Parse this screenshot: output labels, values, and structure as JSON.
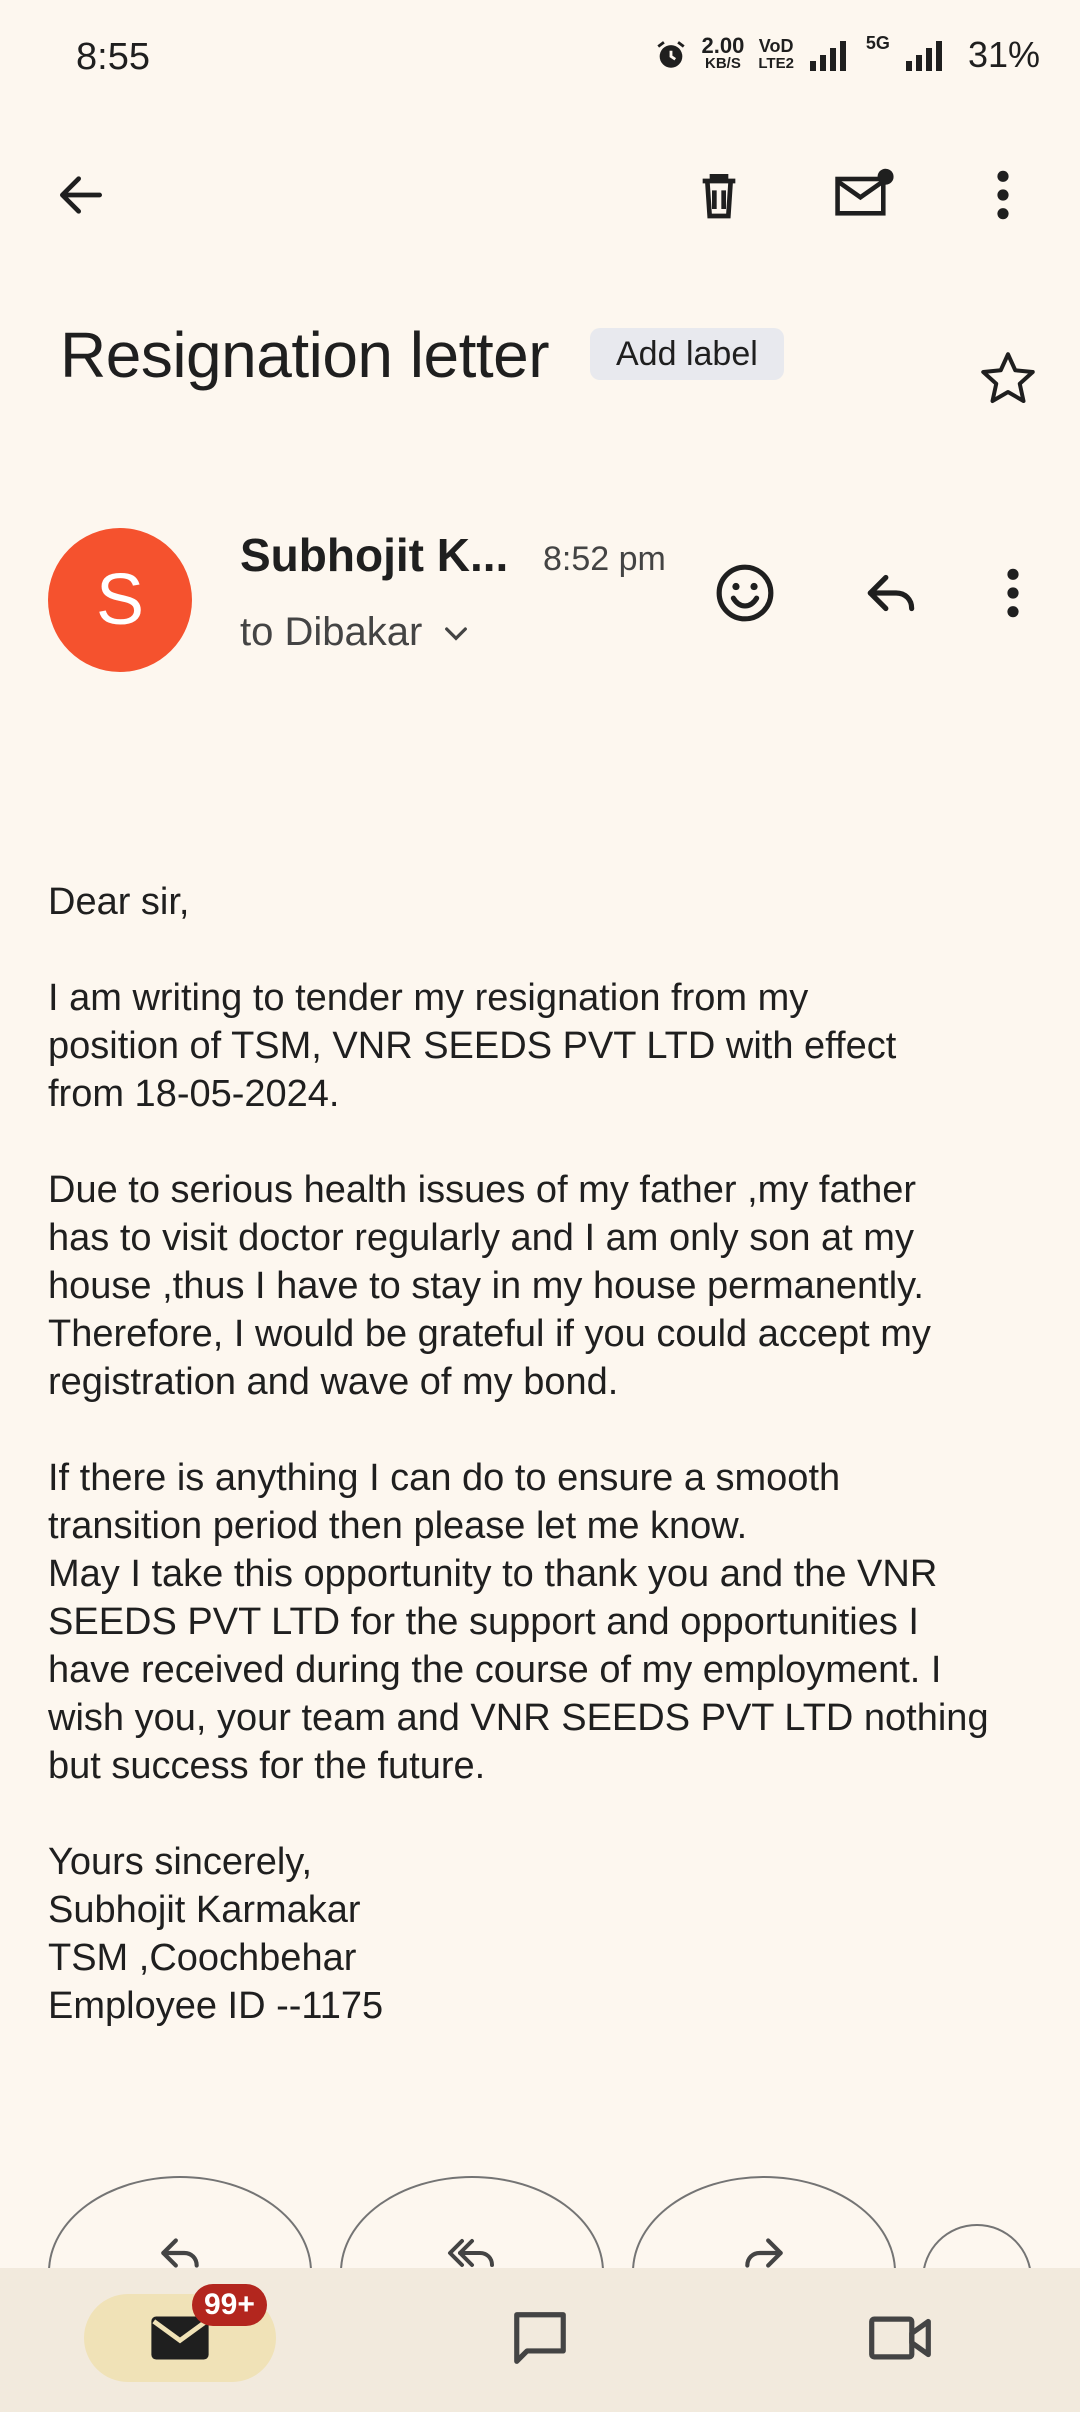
{
  "status_bar": {
    "time": "8:55",
    "net_speed_value": "2.00",
    "net_speed_unit": "KB/S",
    "volte_top": "VoD",
    "volte_bottom": "LTE2",
    "network_5g": "5G",
    "battery": "31%"
  },
  "toolbar": {
    "back_icon": "arrow-left-icon",
    "delete_icon": "trash-icon",
    "mark_unread_icon": "mail-unread-icon",
    "more_icon": "more-vertical-icon"
  },
  "email": {
    "subject": "Resignation letter",
    "label_chip": "Add label",
    "sender_initial": "S",
    "sender_name": "Subhojit K...",
    "time": "8:52 pm",
    "recipient": "to Dibakar",
    "body": [
      "Dear sir,",
      "I am writing to tender my resignation from my\nposition of TSM, VNR SEEDS PVT LTD with effect\nfrom 18-05-2024.",
      "Due to serious health issues of my father ,my father\nhas to visit doctor regularly and I am only son at my\nhouse ,thus I have to stay in my house permanently.\n Therefore, I would be grateful if you could accept my\nregistration and wave of my bond.",
      "If there is anything I can do to ensure a smooth\ntransition period then please let me know.\nMay I take this opportunity to thank you and the VNR\nSEEDS PVT LTD  for the support and opportunities I\nhave received during the course of my employment. I\nwish you, your team and VNR SEEDS PVT LTD nothing\nbut success for the future.",
      "Yours sincerely,\nSubhojit Karmakar\nTSM ,Coochbehar\nEmployee ID --1175"
    ]
  },
  "bottom_nav": {
    "mail_badge": "99+"
  },
  "colors": {
    "background": "#fdf7ef",
    "avatar": "#f5522e",
    "badge": "#b3261e",
    "nav_active": "#f0e2b7"
  }
}
